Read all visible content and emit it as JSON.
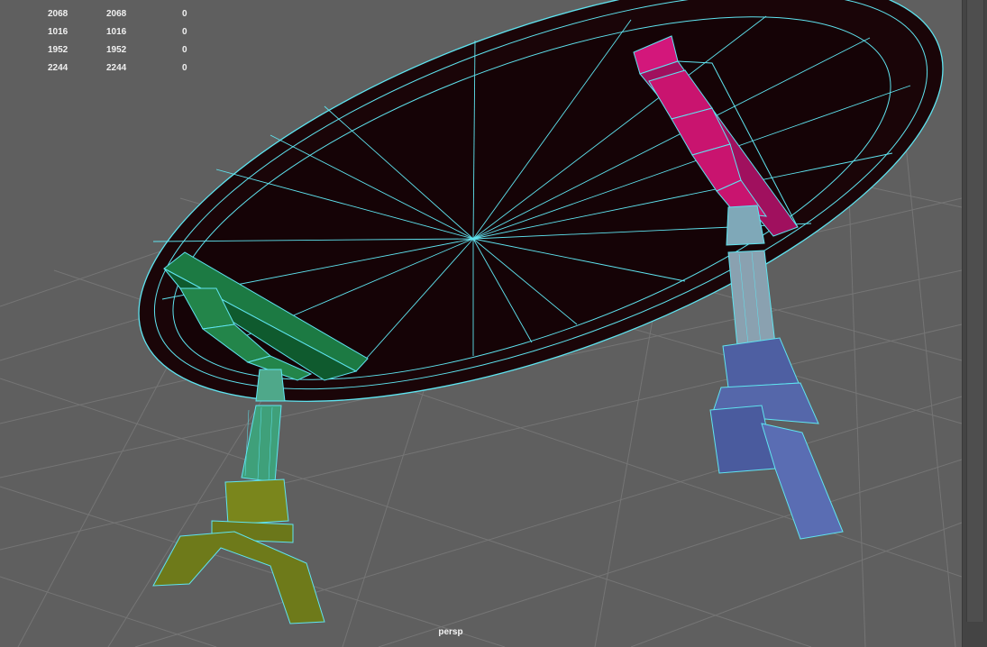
{
  "viewport": {
    "camera_label": "persp",
    "hud_rows": [
      {
        "c1": "2068",
        "c2": "2068",
        "c3": "0"
      },
      {
        "c1": "1016",
        "c2": "1016",
        "c3": "0"
      },
      {
        "c1": "1952",
        "c2": "1952",
        "c3": "0"
      },
      {
        "c1": "2244",
        "c2": "2244",
        "c3": "0"
      }
    ]
  },
  "colors": {
    "viewport_bg": "#5f5f5f",
    "grid_line": "#747474",
    "wireframe": "#5fe4f0",
    "tabletop_fill": "#170406",
    "bracket_magenta": "#c0136e",
    "bracket_green": "#1c7a43",
    "leg_blue": "#4c5fa6",
    "leg_olive": "#6e7a1a",
    "side_panel": "#444444"
  },
  "objects": [
    {
      "name": "tabletop",
      "icon": "mesh-icon"
    },
    {
      "name": "magenta-bracket",
      "icon": "mesh-icon"
    },
    {
      "name": "green-bracket",
      "icon": "mesh-icon"
    },
    {
      "name": "blue-leg",
      "icon": "mesh-icon"
    },
    {
      "name": "olive-leg",
      "icon": "mesh-icon"
    }
  ]
}
